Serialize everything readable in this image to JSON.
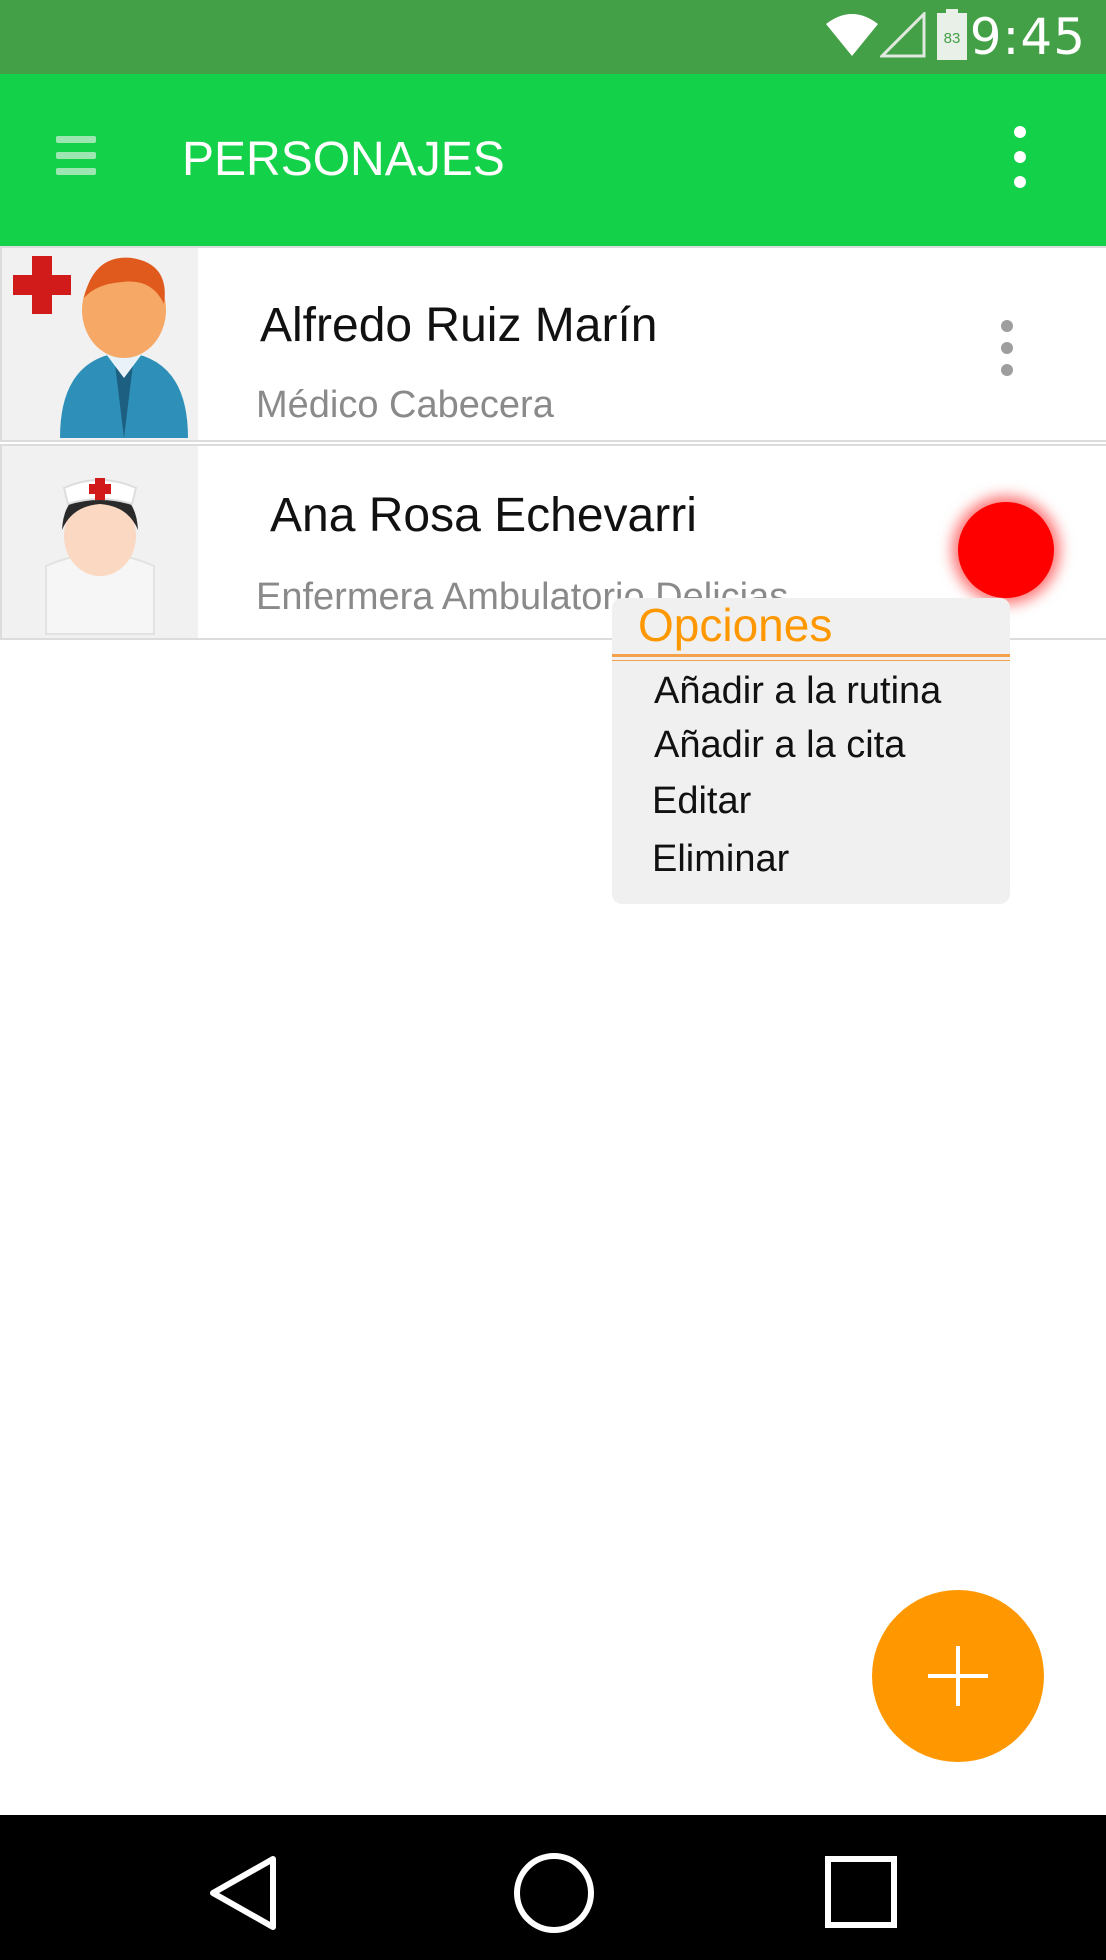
{
  "status_bar": {
    "time": "9:45",
    "battery_level": "83",
    "wifi_icon": "wifi-icon",
    "signal_icon": "cell-signal-icon"
  },
  "app_bar": {
    "title": "PERSONAJES",
    "menu_icon": "hamburger-menu-icon",
    "overflow_icon": "more-vert-icon",
    "color": "#14d14a"
  },
  "contacts": [
    {
      "name": "Alfredo Ruiz Marín",
      "role": "Médico Cabecera",
      "avatar_icon": "doctor-avatar-icon"
    },
    {
      "name": "Ana Rosa Echevarri",
      "role": "Enfermera Ambulatorio Delicias",
      "avatar_icon": "nurse-avatar-icon"
    }
  ],
  "context_menu": {
    "title": "Opciones",
    "items": [
      "Añadir a la rutina",
      "Añadir a la cita",
      "Editar",
      "Eliminar"
    ],
    "accent": "#ff9800"
  },
  "fab": {
    "icon": "plus-icon",
    "color": "#ff9800"
  },
  "nav": {
    "back_icon": "back-triangle-icon",
    "home_icon": "home-circle-icon",
    "recents_icon": "recents-square-icon"
  }
}
